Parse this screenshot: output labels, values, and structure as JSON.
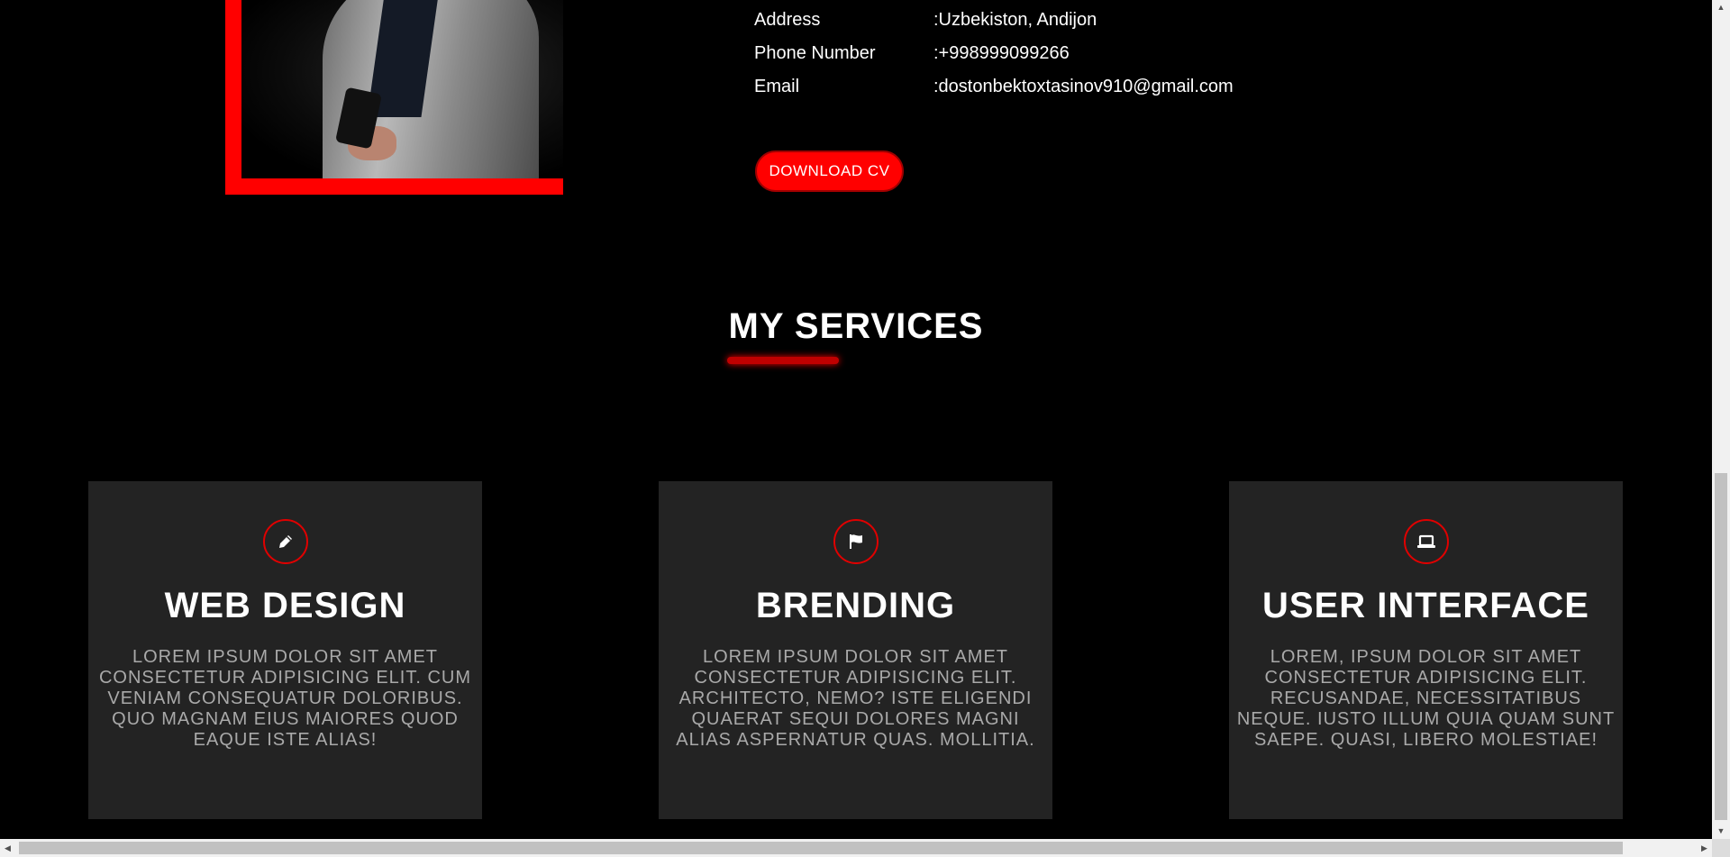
{
  "about": {
    "rows": [
      {
        "label": "Address",
        "value": ":Uzbekiston, Andijon"
      },
      {
        "label": "Phone Number",
        "value": ":+998999099266"
      },
      {
        "label": "Email",
        "value": ":dostonbektoxtasinov910@gmail.com"
      }
    ],
    "download_label": "DOWNLOAD CV"
  },
  "services": {
    "title": "MY SERVICES",
    "cards": [
      {
        "icon": "pencil-icon",
        "title": "WEB DESIGN",
        "text": "Lorem ipsum dolor sit amet consectetur adipisicing elit. Cum veniam consequatur doloribus. Quo magnam eius maiores quod eaque iste alias!"
      },
      {
        "icon": "flag-icon",
        "title": "BRENDING",
        "text": "Lorem ipsum dolor sit amet consectetur adipisicing elit. Architecto, nemo? Iste eligendi quaerat sequi dolores magni alias aspernatur quas. Mollitia."
      },
      {
        "icon": "laptop-icon",
        "title": "USER INTERFACE",
        "text": "Lorem, ipsum dolor sit amet consectetur adipisicing elit. Recusandae, necessitatibus neque. Iusto illum quia quam sunt saepe. Quasi, libero molestiae!"
      }
    ]
  },
  "colors": {
    "accent": "#ff0000",
    "background": "#000000",
    "card": "#232323",
    "muted_text": "#a9a9a9"
  }
}
